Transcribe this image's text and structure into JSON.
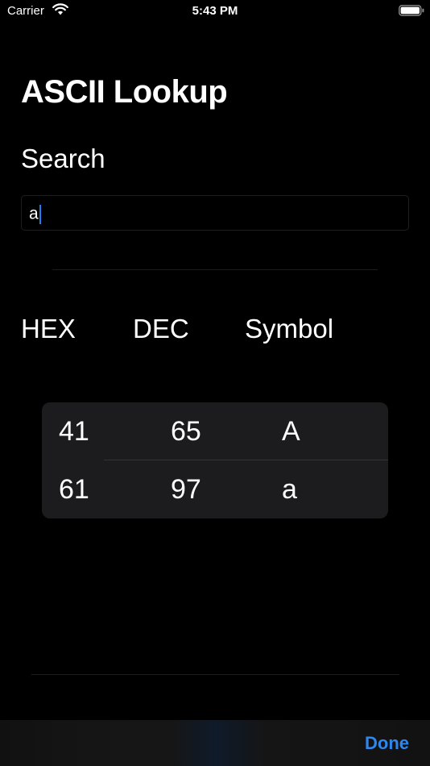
{
  "status_bar": {
    "carrier": "Carrier",
    "time": "5:43 PM"
  },
  "page": {
    "title": "ASCII Lookup",
    "search_label": "Search",
    "search_value": "a"
  },
  "columns": {
    "hex": "HEX",
    "dec": "DEC",
    "symbol": "Symbol"
  },
  "results": [
    {
      "hex": "41",
      "dec": "65",
      "symbol": "A"
    },
    {
      "hex": "61",
      "dec": "97",
      "symbol": "a"
    }
  ],
  "toolbar": {
    "done_label": "Done"
  },
  "colors": {
    "background": "#000000",
    "accent": "#2f86ee",
    "card": "#1c1c1e"
  },
  "icons": {
    "wifi": "wifi-icon",
    "battery": "battery-icon"
  }
}
